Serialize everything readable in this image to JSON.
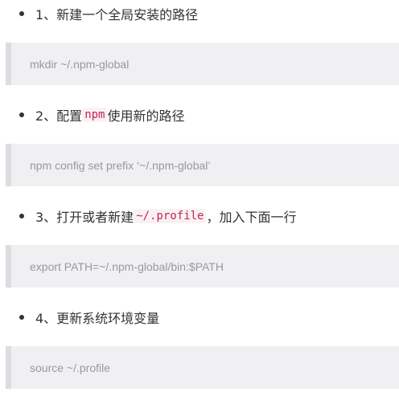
{
  "steps": [
    {
      "pre": "1、新建一个全局安装的路径",
      "code": "",
      "post": "",
      "block": "mkdir ~/.npm-global"
    },
    {
      "pre": "2、配置",
      "code": "npm",
      "post": "使用新的路径",
      "block": "npm config set prefix ‘~/.npm-global’"
    },
    {
      "pre": "3、打开或者新建",
      "code": "~/.profile",
      "post": "，加入下面一行",
      "block": "export PATH=~/.npm-global/bin:$PATH"
    },
    {
      "pre": "4、更新系统环境变量",
      "code": "",
      "post": "",
      "block": "source ~/.profile"
    }
  ]
}
